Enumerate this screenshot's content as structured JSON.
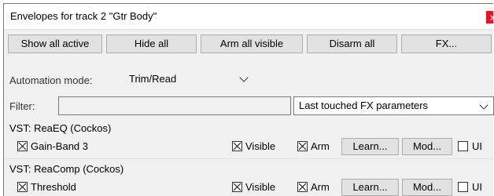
{
  "window": {
    "title": "Envelopes for track 2 \"Gtr Body\"",
    "close_glyph": "x"
  },
  "toolbar": {
    "show_all_active": "Show all active",
    "hide_all": "Hide all",
    "arm_all_visible": "Arm all visible",
    "disarm_all": "Disarm all",
    "fx": "FX..."
  },
  "automation": {
    "label": "Automation mode:",
    "value": "Trim/Read"
  },
  "filter": {
    "label": "Filter:",
    "value": "",
    "fx_scope": "Last touched FX parameters"
  },
  "plugins": [
    {
      "name": "VST: ReaEQ (Cockos)",
      "param": "Gain-Band 3",
      "param_checked": true,
      "visible_label": "Visible",
      "visible_checked": true,
      "arm_label": "Arm",
      "arm_checked": true,
      "learn_label": "Learn...",
      "mod_label": "Mod...",
      "ui_label": "UI",
      "ui_checked": false
    },
    {
      "name": "VST: ReaComp (Cockos)",
      "param": "Threshold",
      "param_checked": true,
      "visible_label": "Visible",
      "visible_checked": true,
      "arm_label": "Arm",
      "arm_checked": true,
      "learn_label": "Learn...",
      "mod_label": "Mod...",
      "ui_label": "UI",
      "ui_checked": false
    }
  ],
  "colors": {
    "close_button": "#e81123",
    "dialog_bg": "#f0f0f0",
    "button_bg": "#e1e1e1"
  }
}
